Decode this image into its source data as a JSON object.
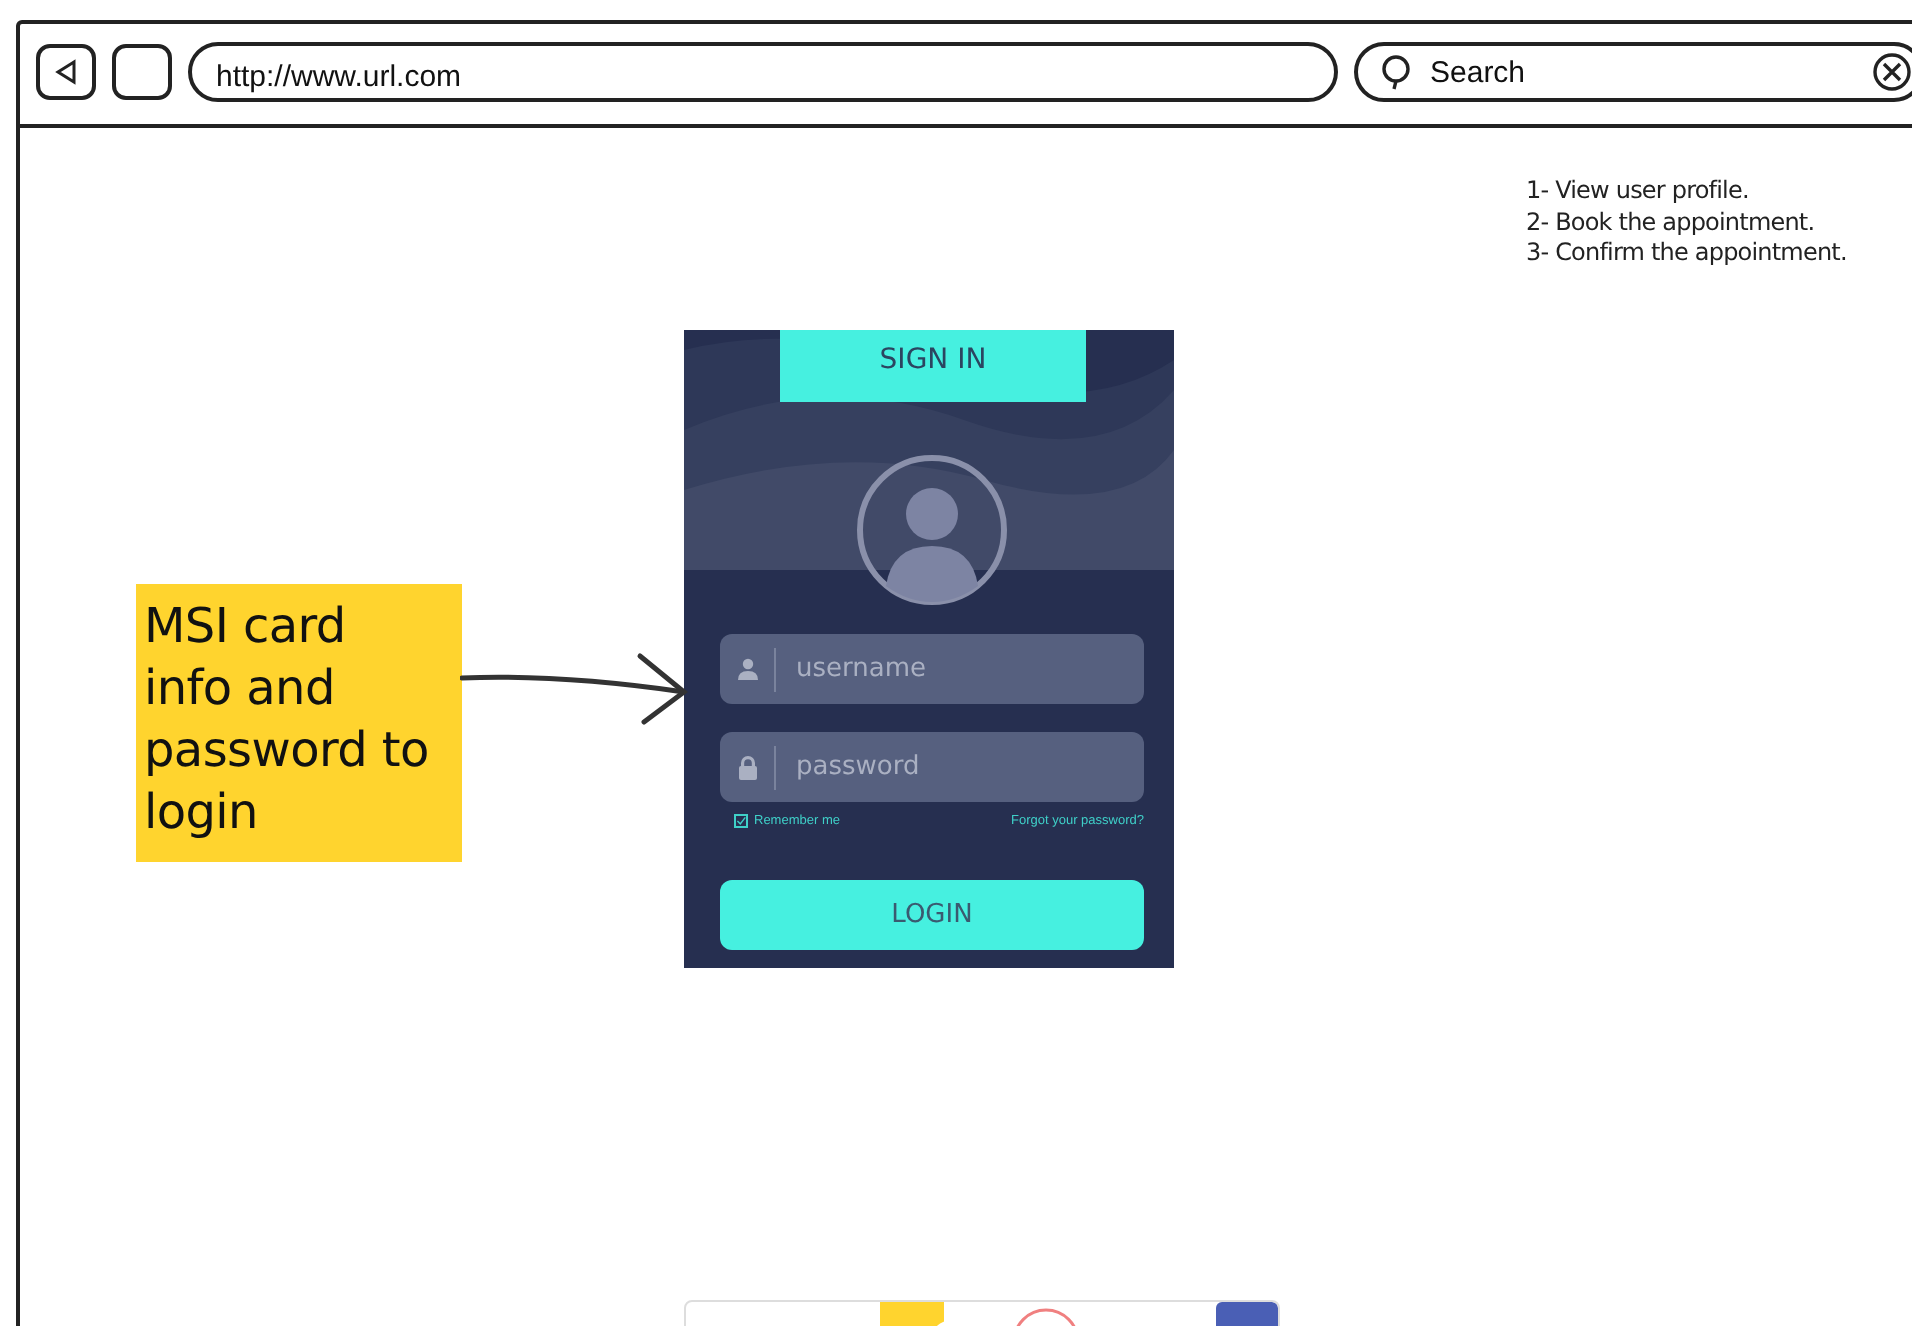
{
  "browser": {
    "url": "http://www.url.com",
    "search_placeholder": "Search"
  },
  "steps": [
    "1- View user profile.",
    "2- Book the appointment.",
    "3- Confirm the appointment."
  ],
  "login_card": {
    "title": "SIGN IN",
    "fields": [
      {
        "kind": "user",
        "placeholder": "username"
      },
      {
        "kind": "lock",
        "placeholder": "password"
      }
    ],
    "remember": {
      "label": "Remember me",
      "checked": true
    },
    "forgot": "Forgot your password?",
    "button": "LOGIN"
  },
  "note": {
    "text": "MSI card info and password to login"
  }
}
